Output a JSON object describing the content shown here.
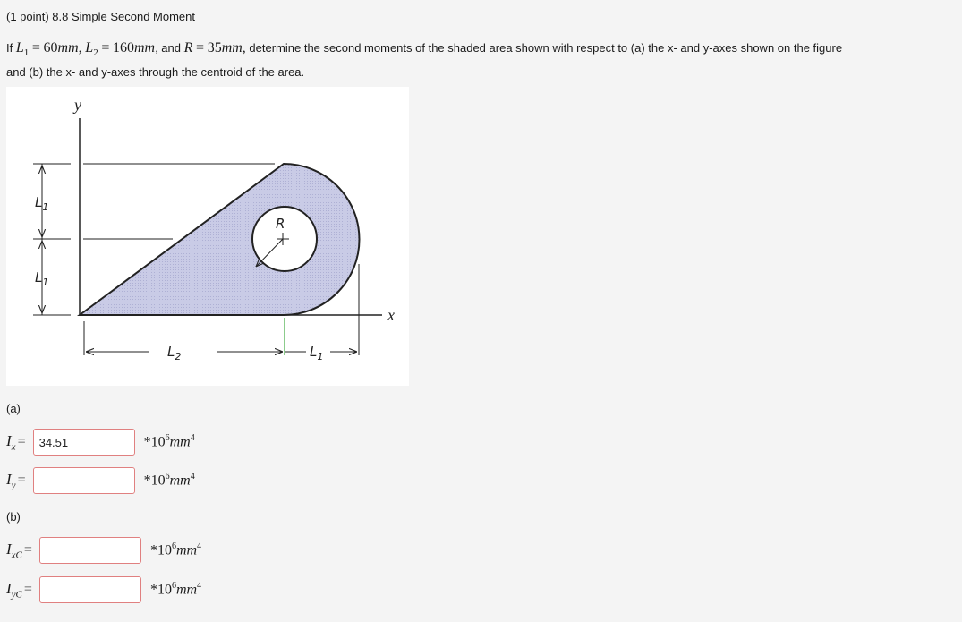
{
  "header": {
    "title": "(1 point) 8.8 Simple Second Moment"
  },
  "problem": {
    "if": "If",
    "L1_sym": "L",
    "L1_sub": "1",
    "eq1": "=",
    "L1_val": "60",
    "L1_unit": "mm",
    "sep1": ",",
    "L2_sym": "L",
    "L2_sub": "2",
    "eq2": "=",
    "L2_val": "160",
    "L2_unit": "mm",
    "sep2": ", and",
    "R_sym": "R",
    "eq3": "=",
    "R_val": "35",
    "R_unit": "mm",
    "sep3": ",",
    "text_line1": "determine the second moments of the shaded area shown with respect to (a) the x- and y-axes shown on the figure",
    "text_line2": "and (b) the x- and y-axes through the centroid of the area."
  },
  "figure": {
    "y_axis": "y",
    "x_axis": "x",
    "label_L1_top": "L",
    "label_L1_top_sub": "1",
    "label_L1_bottom": "L",
    "label_L1_bottom_sub": "1",
    "label_L2": "L",
    "label_L2_sub": "2",
    "label_L1_right": "L",
    "label_L1_right_sub": "1",
    "label_R": "R"
  },
  "part_a": {
    "label": "(a)",
    "Ix": {
      "sym": "I",
      "sub": "x",
      "eq": "=",
      "value": "34.51",
      "unit_prefix": "*10",
      "unit_exp": "6",
      "unit": "mm",
      "unit_pow": "4"
    },
    "Iy": {
      "sym": "I",
      "sub": "y",
      "eq": "=",
      "value": "",
      "unit_prefix": "*10",
      "unit_exp": "6",
      "unit": "mm",
      "unit_pow": "4"
    }
  },
  "part_b": {
    "label": "(b)",
    "IxC": {
      "sym": "I",
      "sub": "xC",
      "eq": "=",
      "value": "",
      "unit_prefix": "*10",
      "unit_exp": "6",
      "unit": "mm",
      "unit_pow": "4"
    },
    "IyC": {
      "sym": "I",
      "sub": "yC",
      "eq": "=",
      "value": "",
      "unit_prefix": "*10",
      "unit_exp": "6",
      "unit": "mm",
      "unit_pow": "4"
    }
  },
  "colors": {
    "shade": "#c9cbe6",
    "input_border": "#e08080",
    "background": "#f4f4f4"
  }
}
